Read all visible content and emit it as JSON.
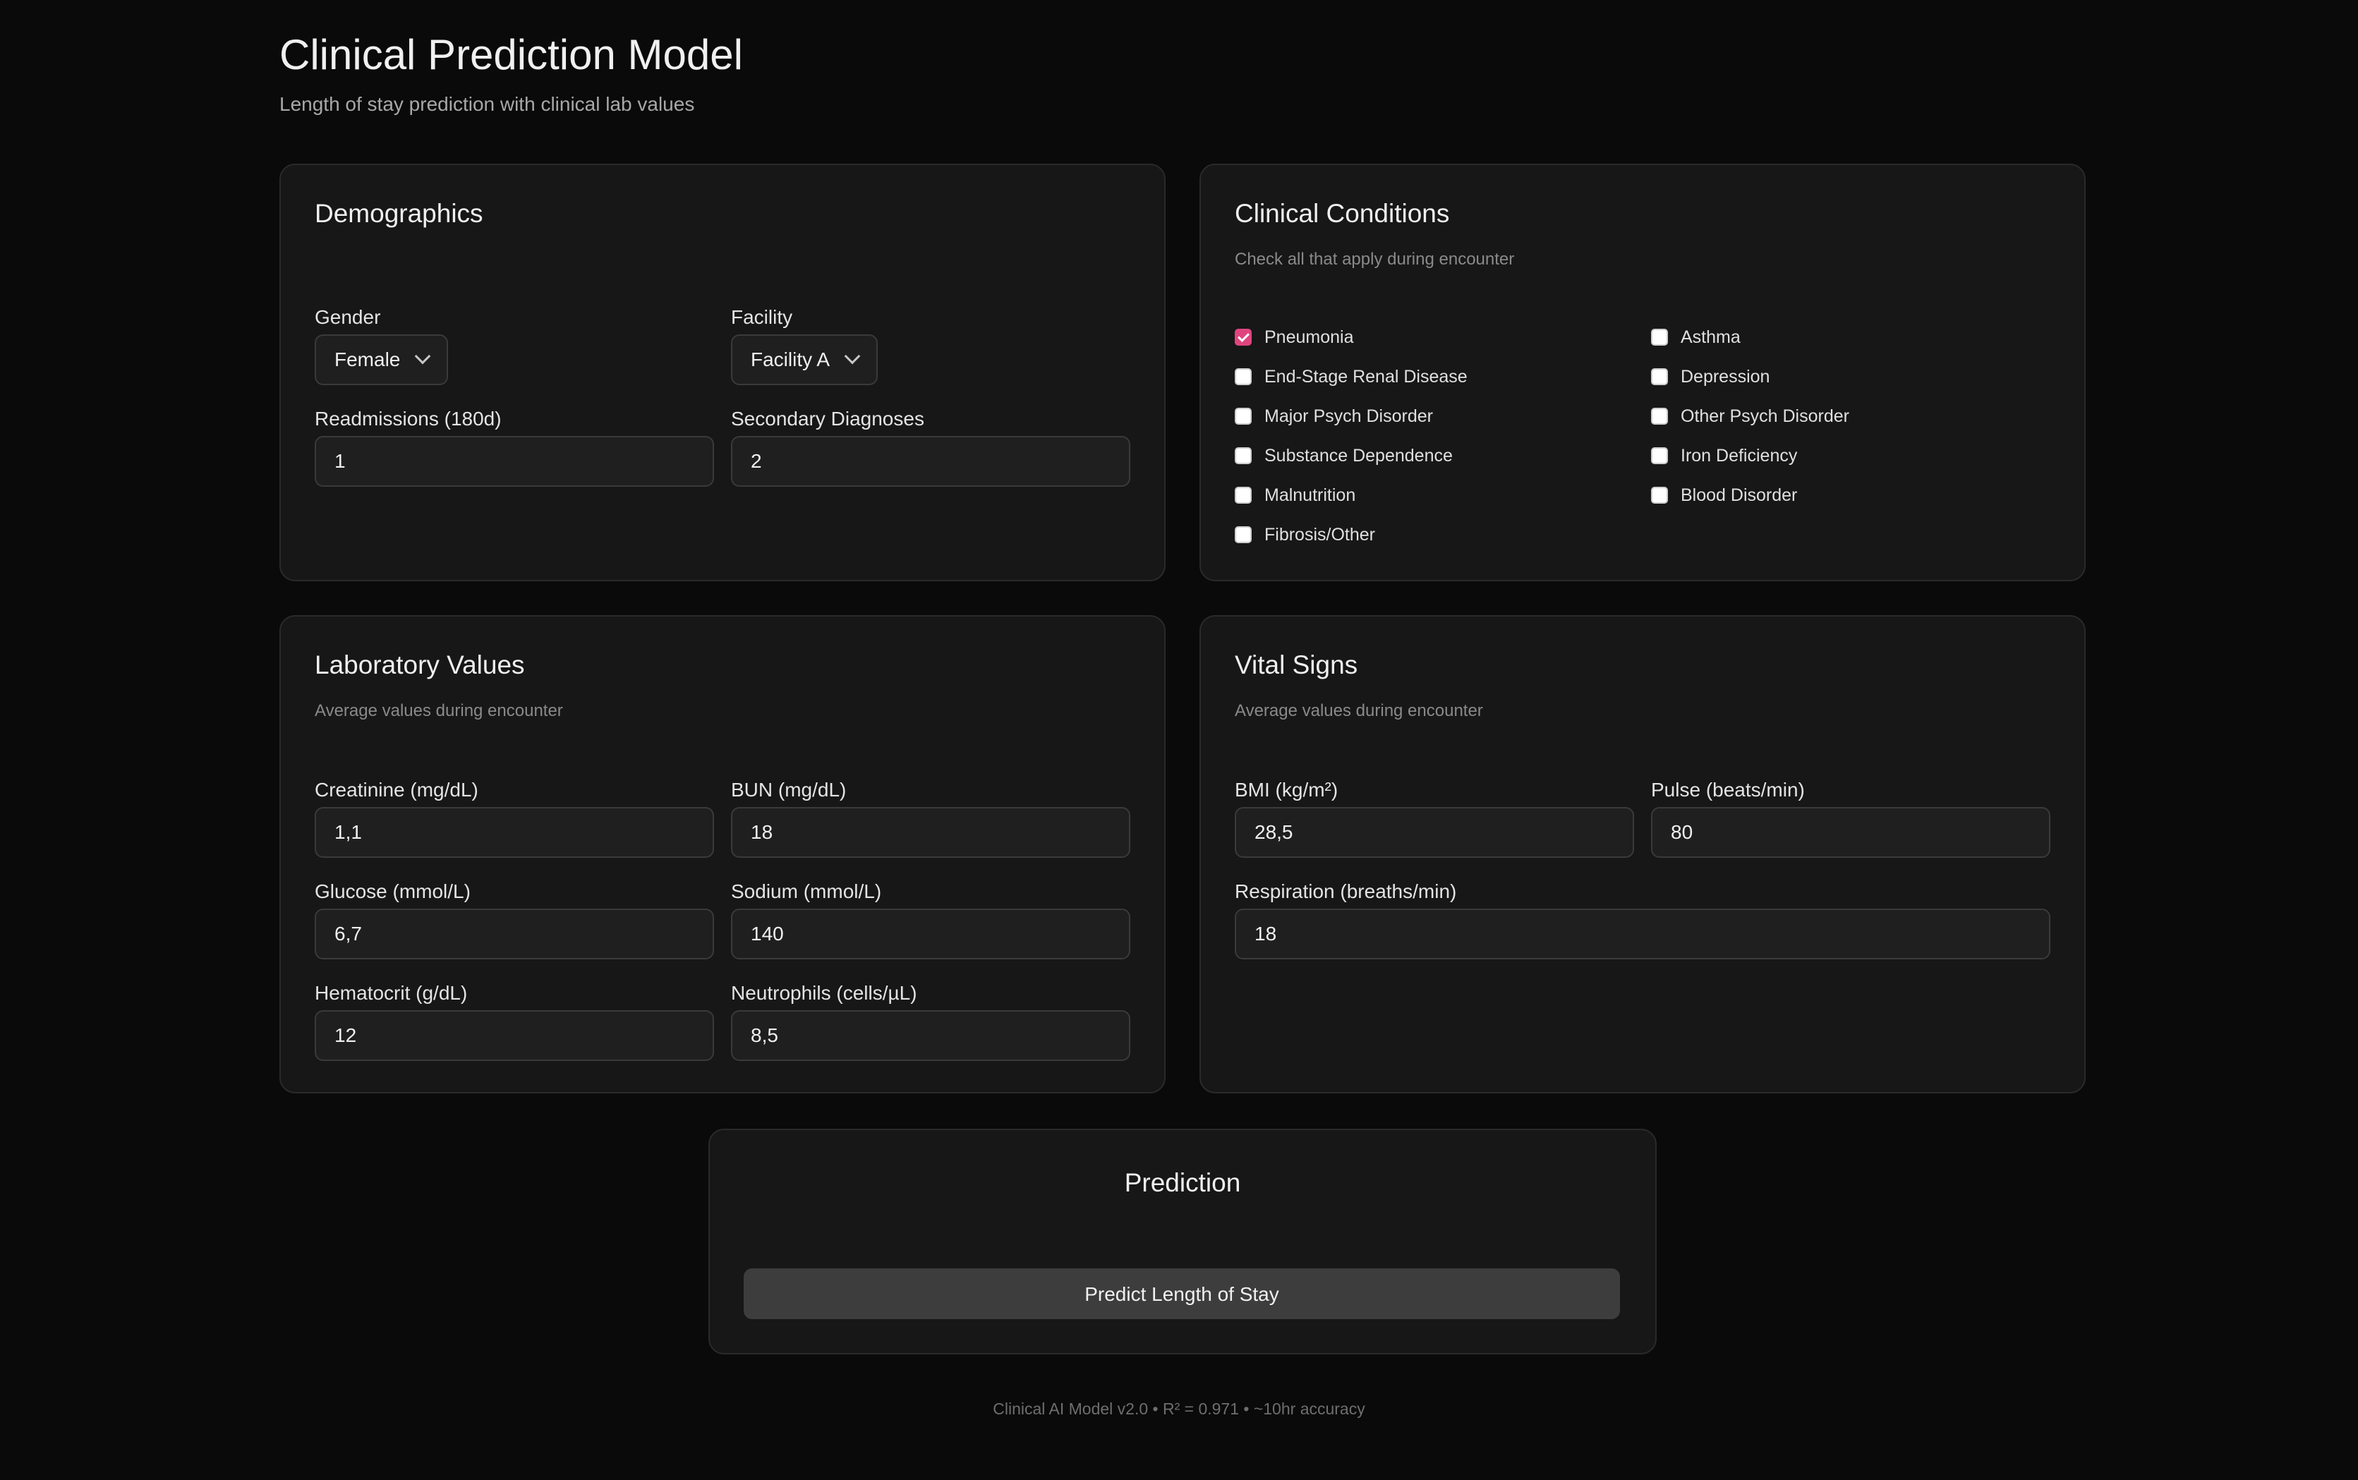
{
  "header": {
    "title": "Clinical Prediction Model",
    "subtitle": "Length of stay prediction with clinical lab values"
  },
  "demographics": {
    "title": "Demographics",
    "gender": {
      "label": "Gender",
      "value": "Female"
    },
    "facility": {
      "label": "Facility",
      "value": "Facility A"
    },
    "readmissions": {
      "label": "Readmissions (180d)",
      "value": "1"
    },
    "secondary_diagnoses": {
      "label": "Secondary Diagnoses",
      "value": "2"
    }
  },
  "conditions": {
    "title": "Clinical Conditions",
    "subtitle": "Check all that apply during encounter",
    "items": [
      {
        "label": "Pneumonia",
        "checked": true
      },
      {
        "label": "End-Stage Renal Disease",
        "checked": false
      },
      {
        "label": "Major Psych Disorder",
        "checked": false
      },
      {
        "label": "Substance Dependence",
        "checked": false
      },
      {
        "label": "Malnutrition",
        "checked": false
      },
      {
        "label": "Fibrosis/Other",
        "checked": false
      },
      {
        "label": "Asthma",
        "checked": false
      },
      {
        "label": "Depression",
        "checked": false
      },
      {
        "label": "Other Psych Disorder",
        "checked": false
      },
      {
        "label": "Iron Deficiency",
        "checked": false
      },
      {
        "label": "Blood Disorder",
        "checked": false
      }
    ]
  },
  "labs": {
    "title": "Laboratory Values",
    "subtitle": "Average values during encounter",
    "creatinine": {
      "label": "Creatinine (mg/dL)",
      "value": "1,1"
    },
    "bun": {
      "label": "BUN (mg/dL)",
      "value": "18"
    },
    "glucose": {
      "label": "Glucose (mmol/L)",
      "value": "6,7"
    },
    "sodium": {
      "label": "Sodium (mmol/L)",
      "value": "140"
    },
    "hematocrit": {
      "label": "Hematocrit (g/dL)",
      "value": "12"
    },
    "neutrophils": {
      "label": "Neutrophils (cells/µL)",
      "value": "8,5"
    }
  },
  "vitals": {
    "title": "Vital Signs",
    "subtitle": "Average values during encounter",
    "bmi": {
      "label": "BMI (kg/m²)",
      "value": "28,5"
    },
    "pulse": {
      "label": "Pulse (beats/min)",
      "value": "80"
    },
    "respiration": {
      "label": "Respiration (breaths/min)",
      "value": "18"
    }
  },
  "prediction": {
    "title": "Prediction",
    "button_label": "Predict Length of Stay"
  },
  "footer": {
    "text": "Clinical AI Model v2.0 • R² = 0.971 • ~10hr accuracy"
  },
  "colors": {
    "background": "#0a0a0a",
    "card": "#171717",
    "accent": "#e0447f"
  }
}
